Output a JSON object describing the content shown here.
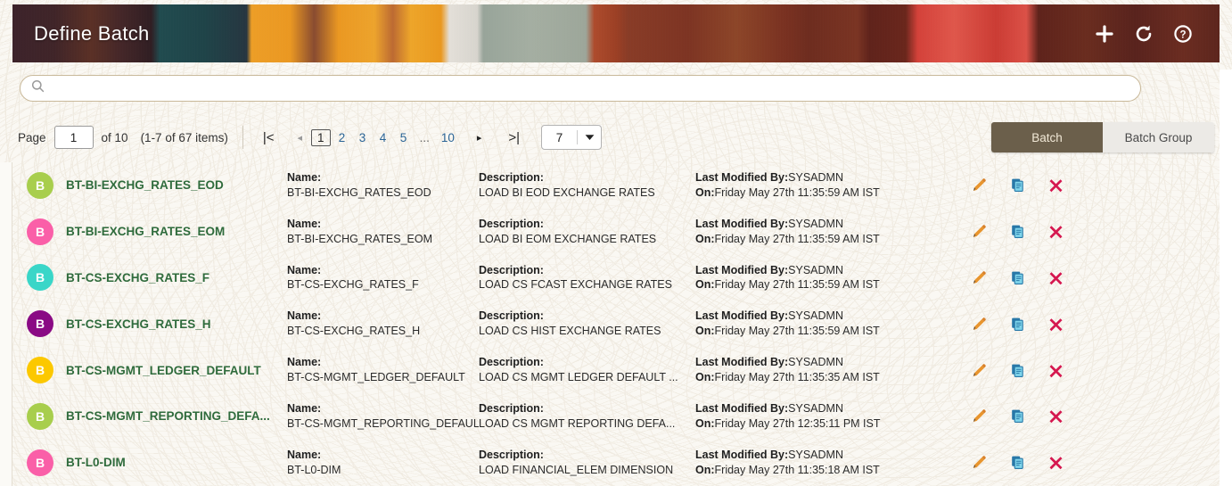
{
  "header": {
    "title": "Define Batch",
    "actions": [
      {
        "name": "add-icon",
        "label": "Add"
      },
      {
        "name": "refresh-icon",
        "label": "Refresh"
      },
      {
        "name": "help-icon",
        "label": "Help"
      }
    ]
  },
  "search": {
    "value": "",
    "placeholder": "",
    "icon": "search-icon"
  },
  "toolbar": {
    "page_label": "Page",
    "page_value": "1",
    "of_label": "of 10",
    "items_label": "(1-7 of 67 items)",
    "first_icon": "|<",
    "prev_icon": "◂",
    "next_icon": "▸",
    "last_icon": ">|",
    "page_numbers": [
      "1",
      "2",
      "3",
      "4",
      "5",
      "...",
      "10"
    ],
    "current_page": "1",
    "page_size": "7",
    "segments": [
      {
        "label": "Batch",
        "active": true
      },
      {
        "label": "Batch Group",
        "active": false
      }
    ]
  },
  "columns": {
    "name_label": "Name:",
    "description_label": "Description:",
    "modified_by_label": "Last Modified By:",
    "modified_on_label": "On:"
  },
  "colors": {
    "banner_title": "#ffffff",
    "batch_name_link": "#2f6b3c",
    "page_link": "#2a6496",
    "segment_active_bg": "#6b5f4b",
    "segment_inactive_bg": "#eceae6",
    "edit_icon": "#e8952e",
    "copy_icon": "#2878a8",
    "delete_icon": "#d5174f",
    "search_border": "#c9b99a",
    "page_background": "#faf8f3"
  },
  "rows": [
    {
      "avatar_letter": "B",
      "avatar_color": "#a8ce4d",
      "title": "BT-BI-EXCHG_RATES_EOD",
      "name": "BT-BI-EXCHG_RATES_EOD",
      "description": "LOAD BI EOD EXCHANGE RATES",
      "modified_by": "SYSADMN",
      "modified_on": "Friday May 27th 11:35:59 AM IST"
    },
    {
      "avatar_letter": "B",
      "avatar_color": "#fa5fa8",
      "title": "BT-BI-EXCHG_RATES_EOM",
      "name": "BT-BI-EXCHG_RATES_EOM",
      "description": "LOAD BI EOM EXCHANGE RATES",
      "modified_by": "SYSADMN",
      "modified_on": "Friday May 27th 11:35:59 AM IST"
    },
    {
      "avatar_letter": "B",
      "avatar_color": "#3ad6c8",
      "title": "BT-CS-EXCHG_RATES_F",
      "name": "BT-CS-EXCHG_RATES_F",
      "description": "LOAD CS FCAST EXCHANGE RATES",
      "modified_by": "SYSADMN",
      "modified_on": "Friday May 27th 11:35:59 AM IST"
    },
    {
      "avatar_letter": "B",
      "avatar_color": "#8a0a84",
      "title": "BT-CS-EXCHG_RATES_H",
      "name": "BT-CS-EXCHG_RATES_H",
      "description": "LOAD CS HIST EXCHANGE RATES",
      "modified_by": "SYSADMN",
      "modified_on": "Friday May 27th 11:35:59 AM IST"
    },
    {
      "avatar_letter": "B",
      "avatar_color": "#fcc800",
      "title": "BT-CS-MGMT_LEDGER_DEFAULT",
      "name": "BT-CS-MGMT_LEDGER_DEFAULT",
      "description": "LOAD CS MGMT LEDGER DEFAULT ...",
      "modified_by": "SYSADMN",
      "modified_on": "Friday May 27th 11:35:35 AM IST"
    },
    {
      "avatar_letter": "B",
      "avatar_color": "#a8ce4d",
      "title": "BT-CS-MGMT_REPORTING_DEFA...",
      "name": "BT-CS-MGMT_REPORTING_DEFAULT",
      "description": "LOAD CS MGMT REPORTING DEFA...",
      "modified_by": "SYSADMN",
      "modified_on": "Friday May 27th 12:35:11 PM IST"
    },
    {
      "avatar_letter": "B",
      "avatar_color": "#fa5fa8",
      "title": "BT-L0-DIM",
      "name": "BT-L0-DIM",
      "description": "LOAD FINANCIAL_ELEM DIMENSION",
      "modified_by": "SYSADMN",
      "modified_on": "Friday May 27th 11:35:18 AM IST"
    }
  ],
  "row_actions": [
    {
      "name": "edit-icon",
      "label": "Edit"
    },
    {
      "name": "copy-icon",
      "label": "Copy"
    },
    {
      "name": "delete-icon",
      "label": "Delete"
    }
  ]
}
